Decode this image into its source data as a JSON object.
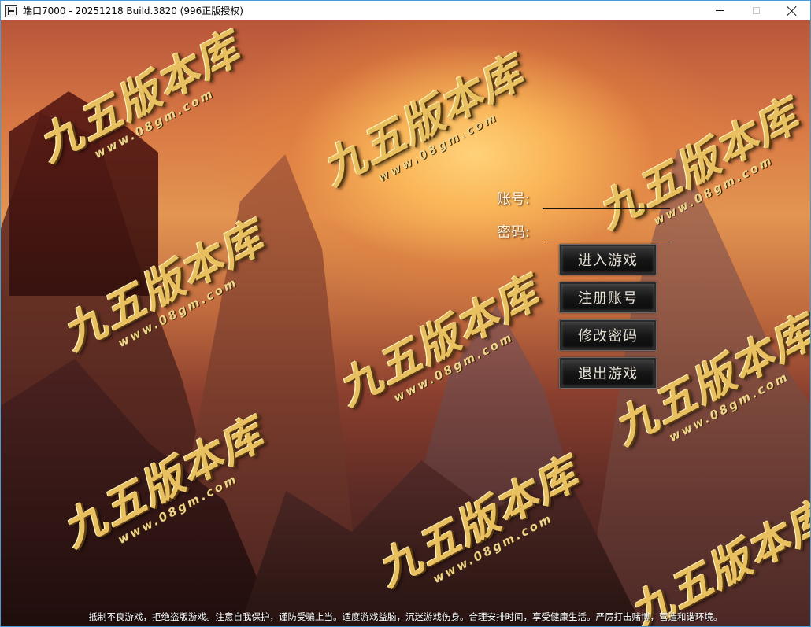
{
  "window": {
    "title": "端口7000 - 20251218 Build.3820 (996正版授权)",
    "controls": {
      "minimize_icon": "minimize-icon",
      "maximize_icon": "maximize-icon",
      "close_icon": "close-icon"
    }
  },
  "watermark": {
    "text": "九五版本库",
    "url": "www.08gm.com",
    "color": "#e8c060"
  },
  "login": {
    "account_label": "账号:",
    "account_value": "",
    "password_label": "密码:",
    "password_value": ""
  },
  "buttons": {
    "enter": "进入游戏",
    "register": "注册账号",
    "change_password": "修改密码",
    "exit": "退出游戏"
  },
  "footer": {
    "notice": "抵制不良游戏，拒绝盗版游戏。注意自我保护，谨防受骗上当。适度游戏益脑，沉迷游戏伤身。合理安排时间，享受健康生活。严厉打击赌博，营造和谐环境。"
  }
}
